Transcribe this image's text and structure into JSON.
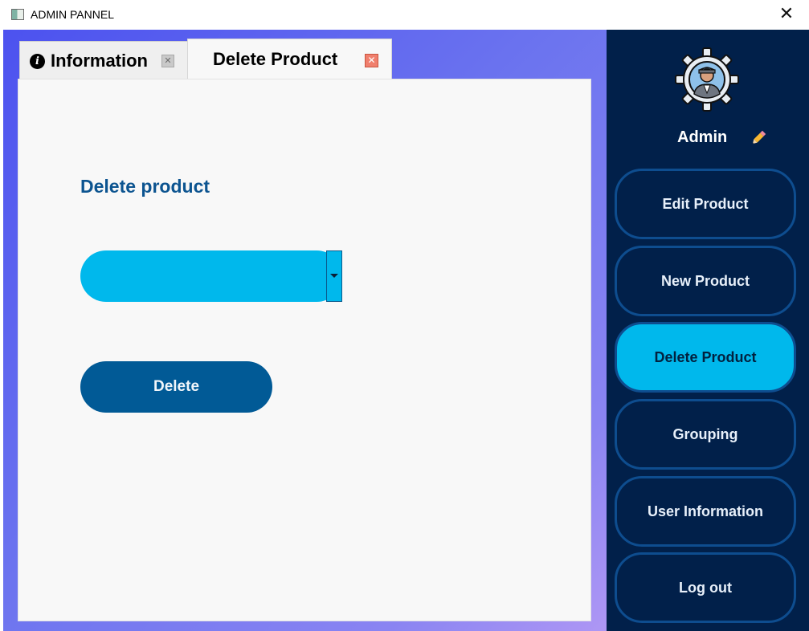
{
  "window": {
    "title": "ADMIN PANNEL",
    "close_glyph": "✕"
  },
  "tabs": [
    {
      "label": "Information",
      "icon": "info-icon",
      "close_glyph": "✕",
      "active": false
    },
    {
      "label": "Delete Product",
      "close_glyph": "✕",
      "active": true
    }
  ],
  "main": {
    "heading": "Delete product",
    "product_select": {
      "value": ""
    },
    "delete_button": "Delete"
  },
  "sidebar": {
    "user_name": "Admin",
    "items": [
      {
        "label": "Edit Product",
        "active": false
      },
      {
        "label": "New Product",
        "active": false
      },
      {
        "label": "Delete Product",
        "active": true
      },
      {
        "label": "Grouping",
        "active": false
      },
      {
        "label": "User Information",
        "active": false
      },
      {
        "label": "Log out",
        "active": false
      }
    ]
  },
  "colors": {
    "accent": "#00b8ec",
    "primary_button": "#015a96",
    "sidebar_bg": "#01204a",
    "heading": "#0c5490"
  }
}
